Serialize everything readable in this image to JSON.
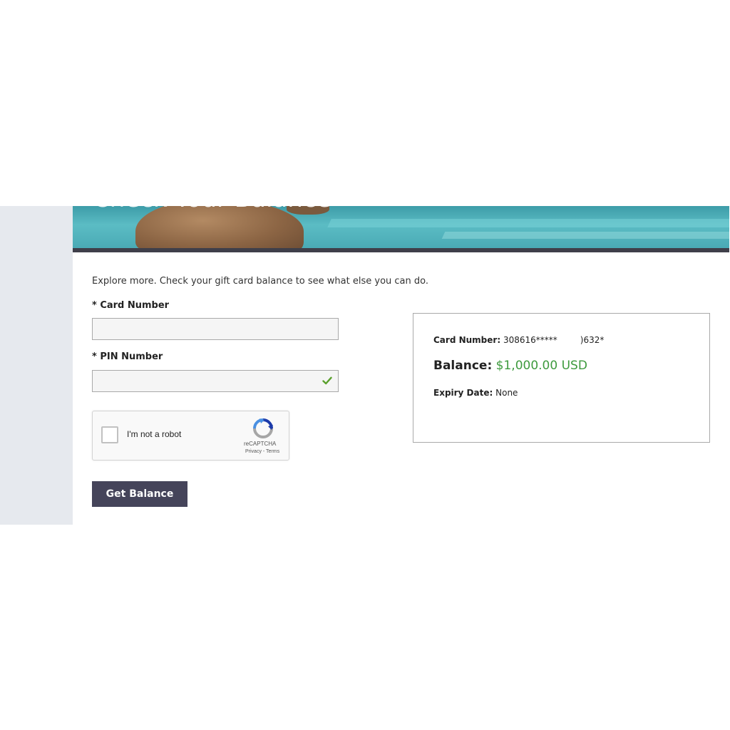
{
  "hero": {
    "title": "Check Your Balance"
  },
  "form": {
    "intro": "Explore more. Check your gift card balance to see what else you can do.",
    "card_number_label": "* Card Number",
    "card_number_value": "",
    "pin_number_label": "* PIN Number",
    "pin_number_value": "",
    "pin_valid_icon": "checkmark-icon",
    "submit_label": "Get Balance"
  },
  "recaptcha": {
    "label": "I'm not a robot",
    "brand": "reCAPTCHA",
    "links": "Privacy - Terms",
    "checked": false
  },
  "result": {
    "card_number_label": "Card Number:",
    "card_number_value_start": "308616*****",
    "card_number_value_end": ")632*",
    "balance_label": "Balance:",
    "balance_value": "$1,000.00 USD",
    "expiry_label": "Expiry Date:",
    "expiry_value": "None"
  },
  "colors": {
    "button_bg": "#45445a",
    "balance_green": "#3e9a3e",
    "check_green": "#5aa02c",
    "gutter": "#e6e9ee"
  }
}
